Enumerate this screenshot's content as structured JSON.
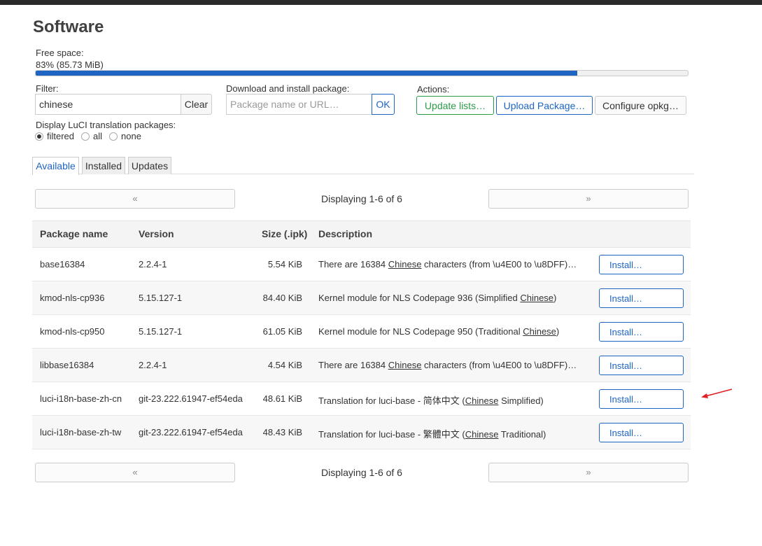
{
  "page": {
    "title": "Software"
  },
  "free_space": {
    "label": "Free space:",
    "value": "83% (85.73 MiB)",
    "percent": 83
  },
  "filter": {
    "label": "Filter:",
    "value": "chinese",
    "clear_label": "Clear"
  },
  "download": {
    "label": "Download and install package:",
    "placeholder": "Package name or URL…",
    "ok_label": "OK"
  },
  "actions": {
    "label": "Actions:",
    "update_lists": "Update lists…",
    "upload_package": "Upload Package…",
    "configure_opkg": "Configure opkg…"
  },
  "luci_translation": {
    "label": "Display LuCI translation packages:",
    "options": [
      {
        "label": "filtered",
        "checked": true
      },
      {
        "label": "all",
        "checked": false
      },
      {
        "label": "none",
        "checked": false
      }
    ]
  },
  "tabs": [
    {
      "label": "Available",
      "active": true
    },
    {
      "label": "Installed",
      "active": false
    },
    {
      "label": "Updates",
      "active": false
    }
  ],
  "pager": {
    "prev": "«",
    "next": "»",
    "status": "Displaying 1-6 of 6"
  },
  "table": {
    "headers": [
      "Package name",
      "Version",
      "Size (.ipk)",
      "Description"
    ],
    "install_label": "Install…",
    "rows": [
      {
        "name": "base16384",
        "version": "2.2.4-1",
        "size": "5.54 KiB",
        "desc_pre": "There are 16384 ",
        "desc_hl": "Chinese",
        "desc_post": " characters (from \\u4E00 to \\u8DFF)…"
      },
      {
        "name": "kmod-nls-cp936",
        "version": "5.15.127-1",
        "size": "84.40 KiB",
        "desc_pre": "Kernel module for NLS Codepage 936 (Simplified ",
        "desc_hl": "Chinese",
        "desc_post": ")"
      },
      {
        "name": "kmod-nls-cp950",
        "version": "5.15.127-1",
        "size": "61.05 KiB",
        "desc_pre": "Kernel module for NLS Codepage 950 (Traditional ",
        "desc_hl": "Chinese",
        "desc_post": ")"
      },
      {
        "name": "libbase16384",
        "version": "2.2.4-1",
        "size": "4.54 KiB",
        "desc_pre": "There are 16384 ",
        "desc_hl": "Chinese",
        "desc_post": " characters (from \\u4E00 to \\u8DFF)…"
      },
      {
        "name": "luci-i18n-base-zh-cn",
        "version": "git-23.222.61947-ef54eda",
        "size": "48.61 KiB",
        "desc_pre": "Translation for luci-base - 简体中文 (",
        "desc_hl": "Chinese",
        "desc_post": " Simplified)"
      },
      {
        "name": "luci-i18n-base-zh-tw",
        "version": "git-23.222.61947-ef54eda",
        "size": "48.43 KiB",
        "desc_pre": "Translation for luci-base - 繁體中文 (",
        "desc_hl": "Chinese",
        "desc_post": " Traditional)"
      }
    ]
  },
  "colors": {
    "accent": "#1d64c3",
    "success": "#2a9c48",
    "annotation_arrow": "#e02020"
  },
  "icons": {
    "annotation": "red-arrow-icon"
  }
}
